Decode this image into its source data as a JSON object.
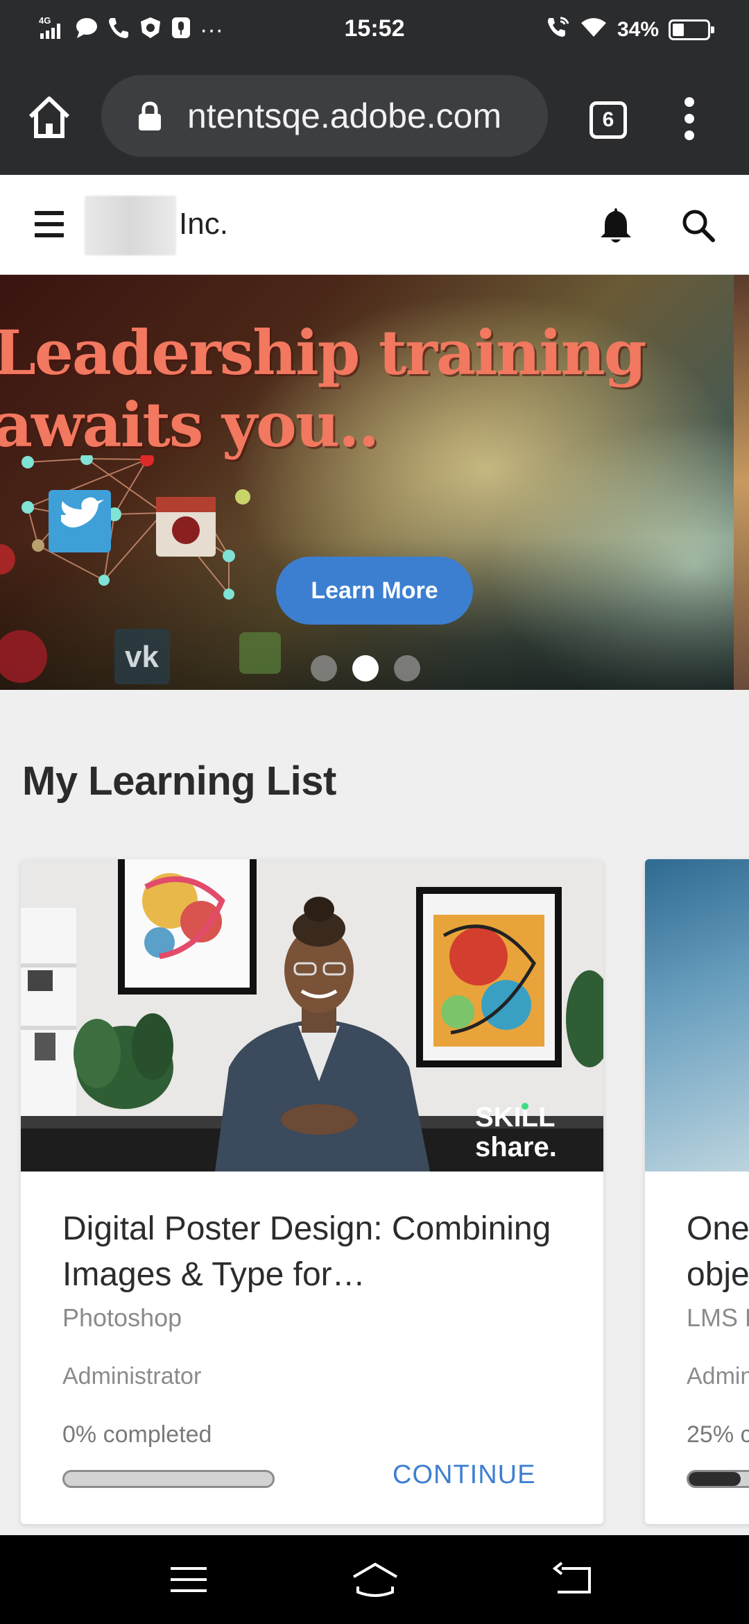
{
  "status_bar": {
    "network": "4G",
    "time": "15:52",
    "battery_text": "34%",
    "battery_level": 0.34,
    "more": "···",
    "icons": [
      "signal-icon",
      "chat-icon",
      "call-icon",
      "vpn-icon",
      "mic-icon",
      "wifi-call-icon",
      "wifi-icon",
      "battery-icon"
    ]
  },
  "browser": {
    "url": "ntentsqe.adobe.com",
    "tab_count": "6",
    "icons": [
      "home-icon",
      "lock-icon",
      "tabs-icon",
      "more-vert-icon"
    ]
  },
  "header": {
    "company": "Inc.",
    "icons": [
      "hamburger-icon",
      "bell-icon",
      "search-icon"
    ]
  },
  "banner": {
    "line1": "Leadership training",
    "line2": "awaits you..",
    "button_label": "Learn More",
    "slides": 3,
    "active_slide": 2
  },
  "section": {
    "title": "My Learning List"
  },
  "cards": [
    {
      "title": "Digital Poster Design: Combining Images & Type for…",
      "category": "Photoshop",
      "author": "Administrator",
      "progress_text": "0% completed",
      "progress": 0.0,
      "action": "CONTINUE",
      "image_watermark_1": "SKILL",
      "image_watermark_2": "share."
    },
    {
      "title_line1": "One",
      "title_line2": "obje",
      "category": "LMS E",
      "author": "Admin",
      "progress_text": "25% c",
      "progress": 0.25
    }
  ],
  "colors": {
    "browser_chrome": "#2b2c2e",
    "accent": "#3c7fd0",
    "banner_text": "#f27860"
  }
}
